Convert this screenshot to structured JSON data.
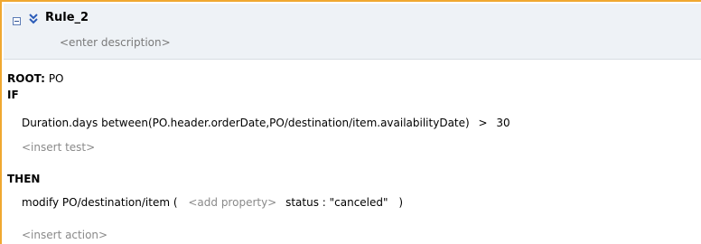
{
  "rule": {
    "name": "Rule_2",
    "description_placeholder": "<enter description>"
  },
  "root": {
    "label": "ROOT:",
    "value": "PO"
  },
  "if_label": "IF",
  "test": {
    "expression": "Duration.days between(PO.header.orderDate,PO/destination/item.availabilityDate)",
    "operator": ">",
    "value": "30",
    "insert_placeholder": "<insert test>"
  },
  "then_label": "THEN",
  "action": {
    "prefix": "modify PO/destination/item (",
    "add_property_placeholder": "<add property>",
    "property": "status : \"canceled\"",
    "suffix": ")",
    "insert_placeholder": "<insert action>"
  },
  "icons": {
    "collapse": "collapse-box-icon",
    "expand": "double-chevron-down-icon"
  },
  "colors": {
    "accent_border": "#f0a830",
    "header_bg": "#eef2f6",
    "placeholder_text": "#8a8a8a"
  }
}
